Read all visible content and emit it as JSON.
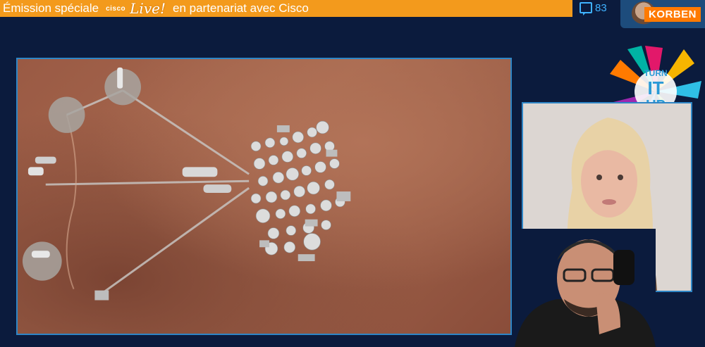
{
  "banner": {
    "title_prefix": "Émission spéciale",
    "brand": "cisco",
    "brand_script": "Live!",
    "title_suffix": "en partenariat avec Cisco",
    "bg_color": "#f39a1c"
  },
  "stats": {
    "viewer_icon": "twitch-icon",
    "viewer_count": "83",
    "streamer_name": "KORBEN"
  },
  "logo": {
    "line1": "TURN",
    "line2": "IT",
    "line3": "UP"
  },
  "colors": {
    "background": "#0b1b3d",
    "frame_border": "#2f86c6",
    "accent_orange": "#ff7a00",
    "twitch_blue": "#3fb2ff"
  }
}
